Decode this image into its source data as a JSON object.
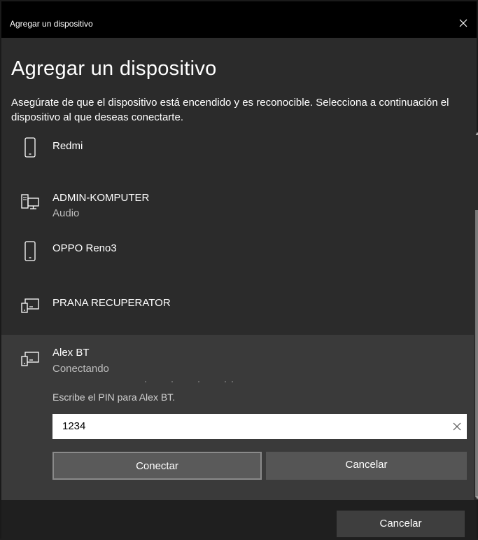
{
  "window": {
    "title": "Agregar un dispositivo"
  },
  "heading": "Agregar un dispositivo",
  "description": "Asegúrate de que el dispositivo está encendido y es reconocible. Selecciona a continuación el dispositivo al que deseas conectarte.",
  "devices": [
    {
      "name": "Redmi",
      "subtitle": "",
      "icon": "phone-icon"
    },
    {
      "name": "ADMIN-KOMPUTER",
      "subtitle": "Audio",
      "icon": "computer-icon"
    },
    {
      "name": "OPPO Reno3",
      "subtitle": "",
      "icon": "phone-icon"
    },
    {
      "name": "PRANA RECUPERATOR",
      "subtitle": "",
      "icon": "device-icon"
    },
    {
      "name": "Alex BT",
      "subtitle": "Conectando",
      "icon": "device-icon"
    }
  ],
  "pairing": {
    "pin_prompt": "Escribe el PIN para Alex BT.",
    "pin_value": "1234",
    "connect_label": "Conectar",
    "cancel_label": "Cancelar"
  },
  "footer": {
    "cancel_label": "Cancelar"
  }
}
